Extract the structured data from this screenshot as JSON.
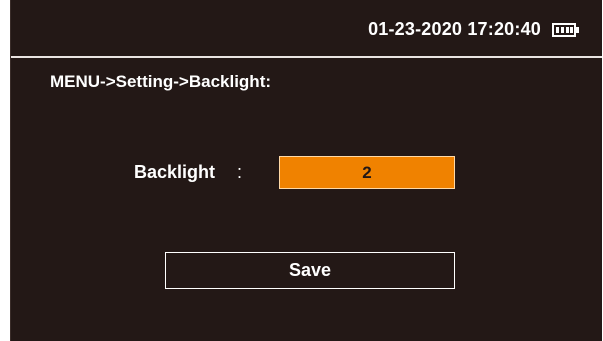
{
  "status_bar": {
    "datetime": "01-23-2020 17:20:40",
    "battery_icon": "battery-full-icon"
  },
  "breadcrumb": "MENU->Setting->Backlight:",
  "setting": {
    "label": "Backlight",
    "colon": ":",
    "value": "2"
  },
  "save_label": "Save",
  "colors": {
    "background": "#231816",
    "accent": "#f08200",
    "text": "#ffffff"
  }
}
